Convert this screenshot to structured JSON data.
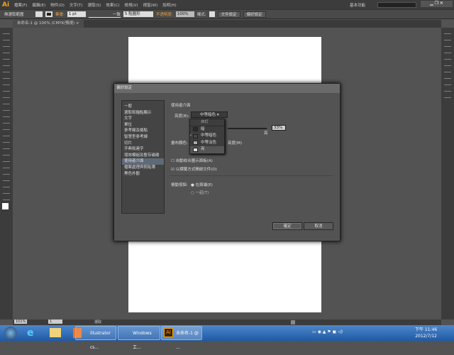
{
  "app": {
    "logo": "Ai",
    "menu": [
      "檔案(F)",
      "編輯(E)",
      "物件(O)",
      "文字(T)",
      "選取(S)",
      "效果(C)",
      "檢視(V)",
      "視窗(W)",
      "說明(H)"
    ],
    "workspace": "基本功能"
  },
  "control": {
    "selection": "無選取範圍",
    "stroke_label": "筆畫:",
    "stroke_value": "1 pt",
    "profile": "一致",
    "brush": "5 點圓形",
    "opacity_label": "不透明度:",
    "opacity_value": "100%",
    "style_label": "樣式:",
    "doc_setup": "文件設定",
    "prefs": "偏好設定"
  },
  "tab": {
    "title": "未命名-1 @ 100% (CMYK/預視)",
    "close": "×"
  },
  "dialog": {
    "title": "偏好設定",
    "list": [
      "一般",
      "選取和錨點顯示",
      "文字",
      "單位",
      "參考線及格點",
      "智慧型參考線",
      "切片",
      "字典和連字",
      "增效模組及暫存磁碟",
      "使用者介面",
      "檔案處理與剪貼簿",
      "黑色外觀"
    ],
    "selected_index": 9,
    "section": "使用者介面",
    "brightness_label": "亮度(B):",
    "brightness_value": "中等暗色",
    "dropdown": {
      "header": "自訂",
      "options": [
        "暗",
        "中等暗色",
        "中等淡色",
        "亮"
      ],
      "checked": "中等暗色",
      "hover": "亮"
    },
    "slider_value": "33%",
    "slider_end": "亮",
    "canvas_label": "畫布顏色:",
    "canvas_option": "亮度(M)",
    "auto_collapse": {
      "label": "自動收合圖示面板(A)",
      "checked": false
    },
    "tabs_open": {
      "label": "以標籤方式開啟文件(O)",
      "checked": true
    },
    "scroll_label": "捲動按鈕:",
    "scroll_options": [
      "在兩端(E)",
      "一起(T)"
    ],
    "scroll_selected": "在兩端(E)",
    "ok": "確定",
    "cancel": "取消"
  },
  "status": {
    "zoom": "101%",
    "page": "1",
    "mode": "選取"
  },
  "taskbar": {
    "items": [
      "illustrator cs...",
      "Windows 工...",
      "未命名-1 @ ..."
    ],
    "time": "下午 11:46",
    "date": "2012/7/12"
  }
}
